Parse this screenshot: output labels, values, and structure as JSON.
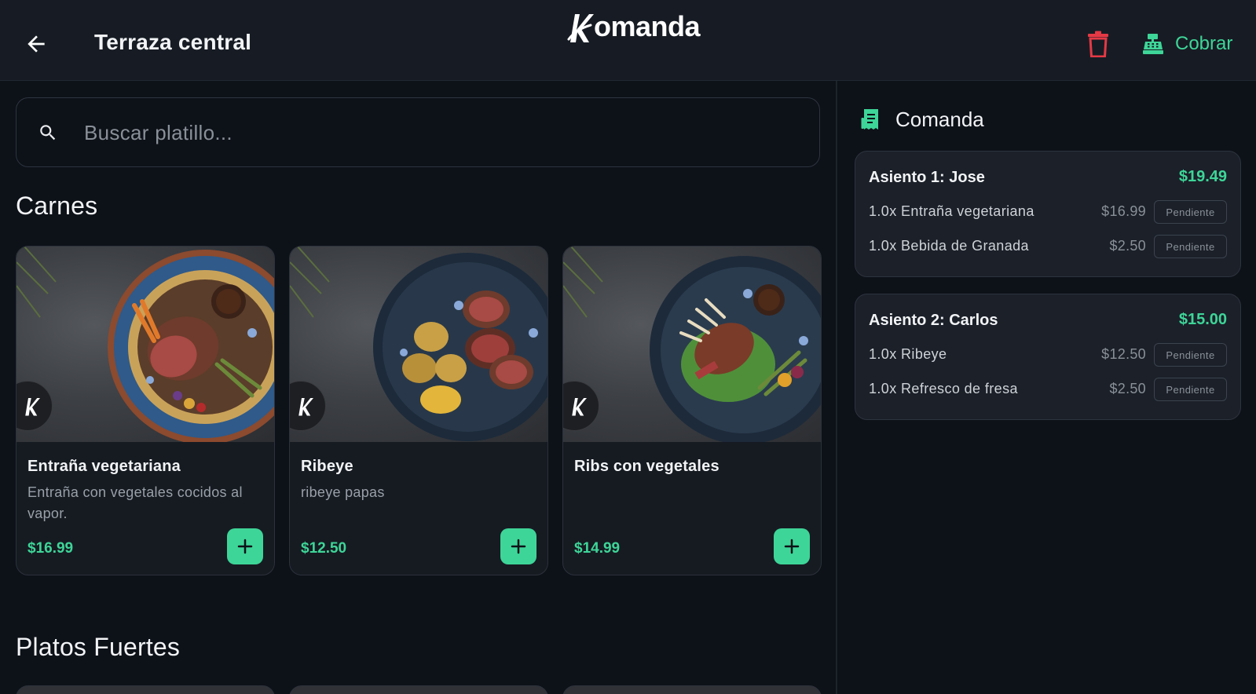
{
  "header": {
    "title": "Terraza central",
    "logo_text": "omanda",
    "cobrar_label": "Cobrar"
  },
  "search": {
    "placeholder": "Buscar platillo..."
  },
  "sections": [
    {
      "title": "Carnes",
      "dishes": [
        {
          "name": "Entraña vegetariana",
          "description": "Entraña con vegetales cocidos al vapor.",
          "price": "$16.99"
        },
        {
          "name": "Ribeye",
          "description": "ribeye papas",
          "price": "$12.50"
        },
        {
          "name": "Ribs con vegetales",
          "description": "",
          "price": "$14.99"
        }
      ]
    },
    {
      "title": "Platos Fuertes",
      "dishes": []
    }
  ],
  "order": {
    "title": "Comanda",
    "seats": [
      {
        "name": "Asiento 1: Jose",
        "total": "$19.49",
        "items": [
          {
            "desc": "1.0x Entraña vegetariana",
            "price": "$16.99",
            "status": "Pendiente"
          },
          {
            "desc": "1.0x Bebida de Granada",
            "price": "$2.50",
            "status": "Pendiente"
          }
        ]
      },
      {
        "name": "Asiento 2: Carlos",
        "total": "$15.00",
        "items": [
          {
            "desc": "1.0x Ribeye",
            "price": "$12.50",
            "status": "Pendiente"
          },
          {
            "desc": "1.0x Refresco de fresa",
            "price": "$2.50",
            "status": "Pendiente"
          }
        ]
      }
    ]
  },
  "colors": {
    "accent": "#3ed598",
    "danger": "#e53945",
    "background": "#0d1118",
    "header": "#171c24"
  },
  "icons": {
    "back": "arrow-left-icon",
    "delete": "trash-icon",
    "checkout": "cash-register-icon",
    "search": "search-icon",
    "order": "receipt-icon",
    "add": "plus-icon",
    "brand": "komanda-k-icon"
  }
}
